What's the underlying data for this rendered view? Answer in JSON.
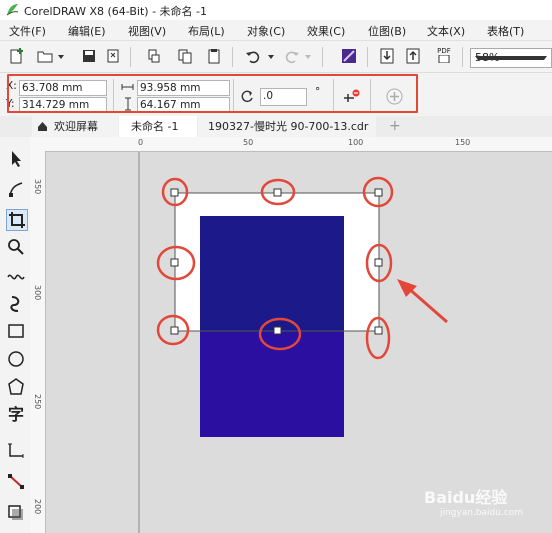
{
  "window": {
    "title": "CorelDRAW X8 (64-Bit) - 未命名 -1"
  },
  "menu": [
    "文件(F)",
    "编辑(E)",
    "视图(V)",
    "布局(L)",
    "对象(C)",
    "效果(C)",
    "位图(B)",
    "文本(X)",
    "表格(T)"
  ],
  "toolbar": {
    "zoom_value": "58%",
    "pdf_label": "PDF"
  },
  "property_bar": {
    "x_label": "X:",
    "x_value": "63.708 mm",
    "y_label": "Y:",
    "y_value": "314.729 mm",
    "width_value": "93.958 mm",
    "height_value": "64.167 mm",
    "rotation_value": ".0",
    "degree_symbol": "°"
  },
  "tabs": {
    "welcome": "欢迎屏幕",
    "doc1": "未命名 -1",
    "doc2": "190327-慢时光 90-700-13.cdr",
    "add": "+"
  },
  "ruler": {
    "h_labels": [
      "0",
      "50",
      "100",
      "150"
    ],
    "v_labels": [
      "350",
      "300",
      "250",
      "200"
    ]
  },
  "colors": {
    "annotation_red": "#e2473a",
    "rect_top": "#1c1a8a",
    "rect_bottom": "#2a0fa0",
    "page_white": "#ffffff"
  },
  "watermark": {
    "text": "Baidu经验",
    "sub": "jingyan.baidu.com"
  }
}
